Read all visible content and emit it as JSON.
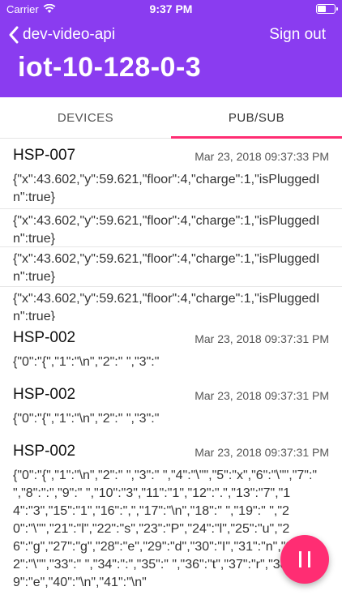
{
  "status": {
    "carrier": "Carrier",
    "time": "9:37 PM"
  },
  "nav": {
    "back_label": "dev-video-api",
    "signout_label": "Sign out"
  },
  "title": "iot-10-128-0-3",
  "tabs": [
    {
      "label": "DEVICES"
    },
    {
      "label": "PUB/SUB"
    }
  ],
  "messages": [
    {
      "device": "HSP-007",
      "time": "Mar 23, 2018 09:37:33 PM",
      "payloads": [
        "{\"x\":43.602,\"y\":59.621,\"floor\":4,\"charge\":1,\"isPluggedIn\":true}",
        "{\"x\":43.602,\"y\":59.621,\"floor\":4,\"charge\":1,\"isPluggedIn\":true}",
        "{\"x\":43.602,\"y\":59.621,\"floor\":4,\"charge\":1,\"isPluggedIn\":true}",
        "{\"x\":43.602,\"y\":59.621,\"floor\":4,\"charge\":1,\"isPluggedIn\":true}"
      ]
    },
    {
      "device": "HSP-002",
      "time": "Mar 23, 2018 09:37:31 PM",
      "payload": "{\"0\":\"{\",\"1\":\"\\n\",\"2\":\" \",\"3\":\""
    },
    {
      "device": "HSP-002",
      "time": "Mar 23, 2018 09:37:31 PM",
      "payload": "{\"0\":\"{\",\"1\":\"\\n\",\"2\":\" \",\"3\":\""
    },
    {
      "device": "HSP-002",
      "time": "Mar 23, 2018 09:37:31 PM",
      "payload": "{\"0\":\"{\",\"1\":\"\\n\",\"2\":\" \",\"3\":\" \",\"4\":\"\\\"\",\"5\":\"x\",\"6\":\"\\\"\",\"7\":\" \",\"8\":\":\",\"9\":\" \",\"10\":\"3\",\"11\":\"1\",\"12\":\".\",\"13\":\"7\",\"14\":\"3\",\"15\":\"1\",\"16\":\",\",\"17\":\"\\n\",\"18\":\" \",\"19\":\" \",\"20\":\"\\\"\",\"21\":\"l\",\"22\":\"s\",\"23\":\"P\",\"24\":\"l\",\"25\":\"u\",\"26\":\"g\",\"27\":\"g\",\"28\":\"e\",\"29\":\"d\",\"30\":\"I\",\"31\":\"n\",\"32\":\"\\\"\",\"33\":\" \",\"34\":\":\",\"35\":\" \",\"36\":\"t\",\"37\":\"r\",\"38\":\"u\",\"39\":\"e\",\"40\":\"\\n\",\"41\":\"\\n\""
    }
  ],
  "fab": {
    "icon": "pause-icon"
  }
}
